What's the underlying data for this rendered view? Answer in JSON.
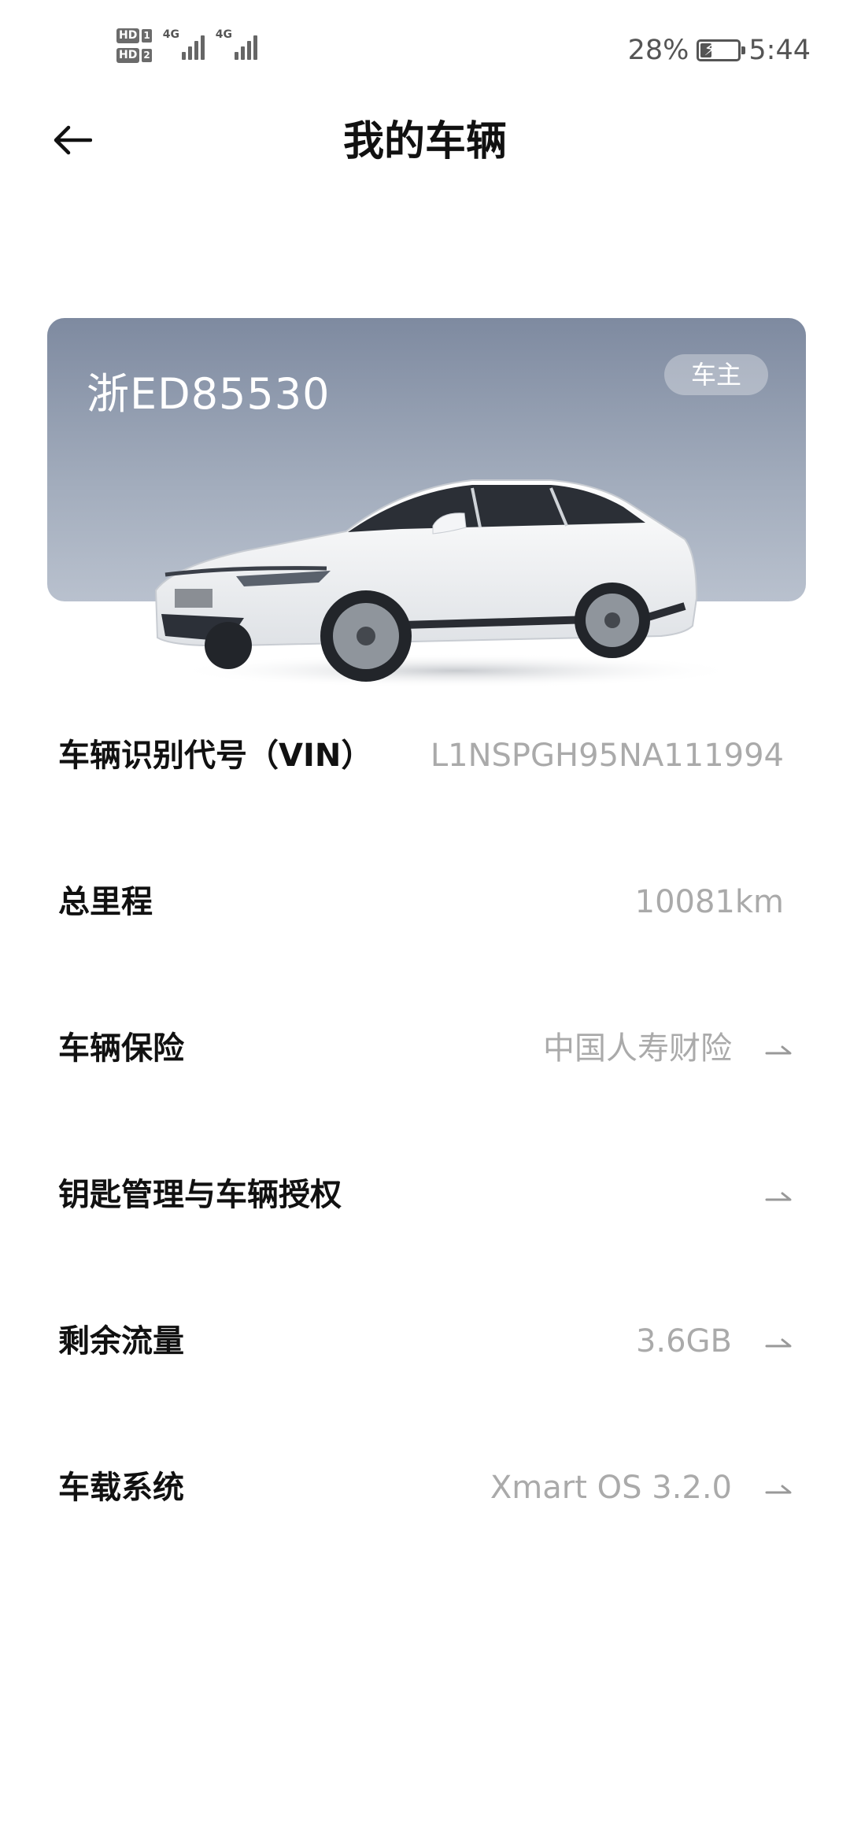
{
  "status_bar": {
    "hd1": "HD",
    "hd1_num": "1",
    "hd2": "HD",
    "hd2_num": "2",
    "net1": "4G",
    "net2": "4G",
    "battery": "28%",
    "time": "5:44"
  },
  "header": {
    "title": "我的车辆"
  },
  "vehicle": {
    "plate": "浙ED85530",
    "role": "车主"
  },
  "rows": [
    {
      "label": "车辆识别代号（VIN）",
      "value": "L1NSPGH95NA111994"
    },
    {
      "label": "总里程",
      "value": "10081km"
    },
    {
      "label": "车辆保险",
      "value": "中国人寿财险"
    },
    {
      "label": "钥匙管理与车辆授权",
      "value": ""
    },
    {
      "label": "剩余流量",
      "value": "3.6GB"
    },
    {
      "label": "车载系统",
      "value": "Xmart OS 3.2.0"
    }
  ],
  "icons": {
    "back": "arrow-left-icon",
    "row_arrow": "arrow-right-icon",
    "battery": "battery-charging-icon"
  },
  "colors": {
    "card_top": "#7e8aa0",
    "card_bottom": "#b9c1ce",
    "value_text": "#aaaaaa"
  }
}
